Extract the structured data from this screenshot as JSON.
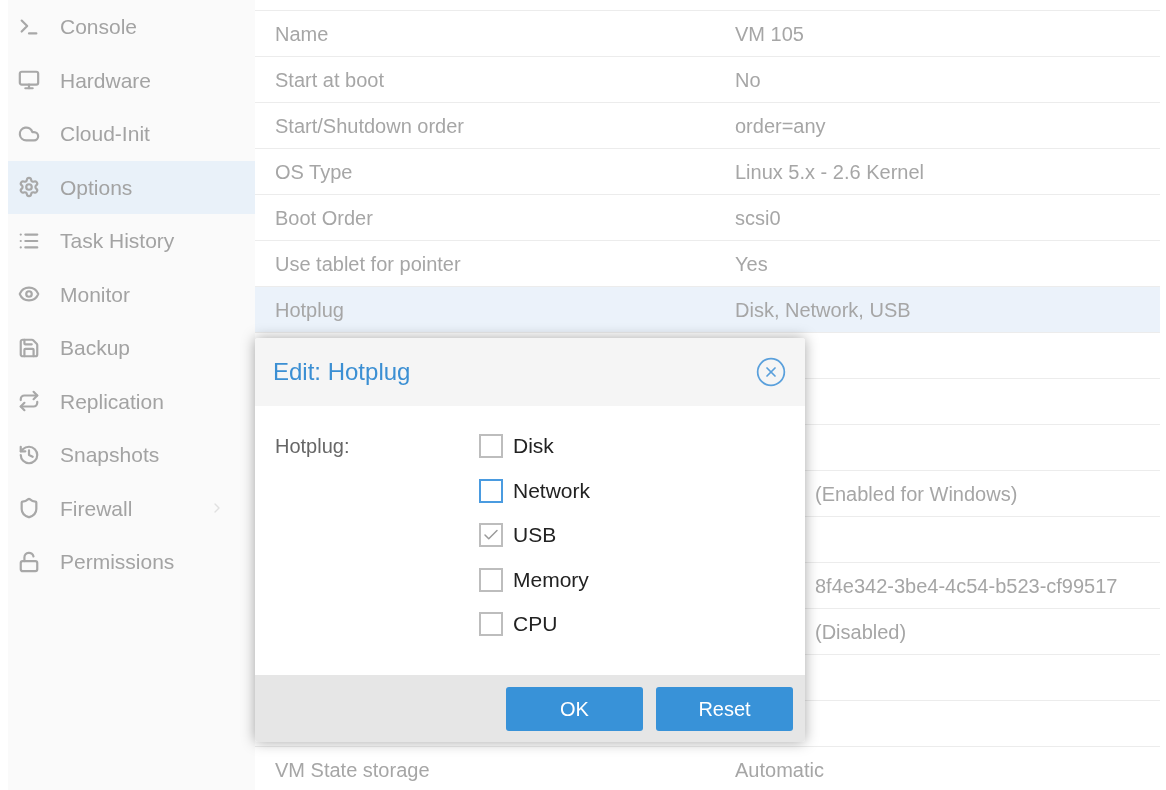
{
  "sidebar": {
    "items": [
      {
        "label": "Console",
        "selected": false,
        "has_submenu": false
      },
      {
        "label": "Hardware",
        "selected": false,
        "has_submenu": false
      },
      {
        "label": "Cloud-Init",
        "selected": false,
        "has_submenu": false
      },
      {
        "label": "Options",
        "selected": true,
        "has_submenu": false
      },
      {
        "label": "Task History",
        "selected": false,
        "has_submenu": false
      },
      {
        "label": "Monitor",
        "selected": false,
        "has_submenu": false
      },
      {
        "label": "Backup",
        "selected": false,
        "has_submenu": false
      },
      {
        "label": "Replication",
        "selected": false,
        "has_submenu": false
      },
      {
        "label": "Snapshots",
        "selected": false,
        "has_submenu": false
      },
      {
        "label": "Firewall",
        "selected": false,
        "has_submenu": true
      },
      {
        "label": "Permissions",
        "selected": false,
        "has_submenu": false
      }
    ]
  },
  "options_grid": {
    "rows": [
      {
        "kind": "full",
        "name": "Name",
        "value": "VM 105",
        "selected": false
      },
      {
        "kind": "full",
        "name": "Start at boot",
        "value": "No",
        "selected": false
      },
      {
        "kind": "full",
        "name": "Start/Shutdown order",
        "value": "order=any",
        "selected": false
      },
      {
        "kind": "full",
        "name": "OS Type",
        "value": "Linux 5.x - 2.6 Kernel",
        "selected": false
      },
      {
        "kind": "full",
        "name": "Boot Order",
        "value": "scsi0",
        "selected": false
      },
      {
        "kind": "full",
        "name": "Use tablet for pointer",
        "value": "Yes",
        "selected": false
      },
      {
        "kind": "full",
        "name": "Hotplug",
        "value": "Disk, Network, USB",
        "selected": true
      },
      {
        "kind": "covered",
        "selected": false
      },
      {
        "kind": "covered",
        "selected": false
      },
      {
        "kind": "covered",
        "selected": false
      },
      {
        "kind": "covered",
        "value": "(Enabled for Windows)",
        "selected": false
      },
      {
        "kind": "covered",
        "selected": false
      },
      {
        "kind": "covered",
        "value": "8f4e342-3be4-4c54-b523-cf99517",
        "selected": false
      },
      {
        "kind": "covered",
        "value": "(Disabled)",
        "selected": false
      },
      {
        "kind": "covered",
        "selected": false
      },
      {
        "kind": "covered",
        "selected": false
      },
      {
        "kind": "full",
        "name": "VM State storage",
        "value": "Automatic",
        "selected": false
      }
    ]
  },
  "dialog": {
    "title": "Edit: Hotplug",
    "field_label": "Hotplug:",
    "options": [
      {
        "label": "Disk",
        "checked": false,
        "focused": false
      },
      {
        "label": "Network",
        "checked": false,
        "focused": true
      },
      {
        "label": "USB",
        "checked": true,
        "focused": false
      },
      {
        "label": "Memory",
        "checked": false,
        "focused": false
      },
      {
        "label": "CPU",
        "checked": false,
        "focused": false
      }
    ],
    "buttons": [
      "OK",
      "Reset"
    ]
  }
}
